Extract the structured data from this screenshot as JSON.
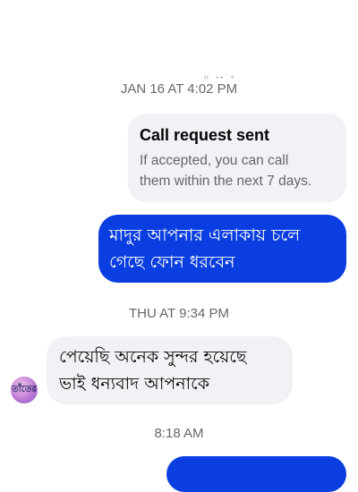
{
  "timestamps": {
    "first": "JAN 16 AT 4:02 PM",
    "second": "THU AT 9:34 PM",
    "third": "8:18 AM"
  },
  "overlay_text": "ᑊᑊ ᕀᐩ ᐪ",
  "call_request": {
    "title": "Call request sent",
    "body_line1": "If accepted, you can call",
    "body_line2": "them within the next 7 days."
  },
  "messages": [
    {
      "direction": "sent",
      "line1": "মাদুর আপনার এলাকায় চলে",
      "line2": "গেছে ফোন ধরবেন"
    },
    {
      "direction": "received",
      "line1": "পেয়েছি অনেক সুন্দর হয়েছে",
      "line2": "ভাই ধন্যবাদ আপনাকে"
    }
  ],
  "avatar": {
    "label": "তাঁতের"
  },
  "colors": {
    "sent_bubble": "#0b3ee0",
    "received_bubble": "#f0f2f5",
    "timestamp": "#65676b"
  }
}
